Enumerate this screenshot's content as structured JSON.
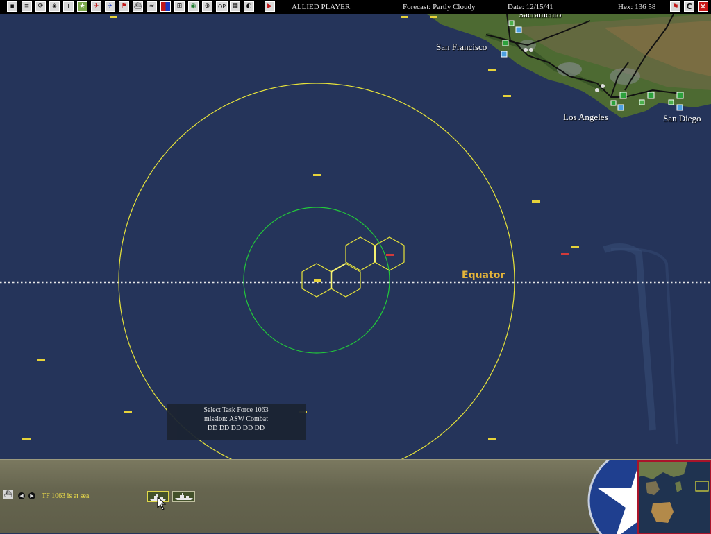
{
  "toolbar": {
    "player": "ALLIED PLAYER",
    "forecast": "Forecast: Partly Cloudy",
    "date": "Date: 12/15/41",
    "hex": "Hex: 136 58",
    "op_label": "OP",
    "info_label": "i",
    "close_label": "✕",
    "collapse_label": "C"
  },
  "map": {
    "cities": {
      "sacramento": "Sacramento",
      "san_francisco": "San Francisco",
      "los_angeles": "Los Angeles",
      "san_diego": "San Diego"
    },
    "equator_label": "Equator"
  },
  "tooltip": {
    "line1": "Select Task Force 1063",
    "line2": "mission: ASW Combat",
    "line3": "DD DD DD DD DD"
  },
  "bottom": {
    "status": "TF 1063 is at sea"
  },
  "colors": {
    "ocean": "#25345a",
    "range_outer": "#e6e23a",
    "range_inner": "#22c93a",
    "hex_outline": "#e6e23a",
    "equator_label": "#e4b43a",
    "status_text": "#f2e24a"
  }
}
